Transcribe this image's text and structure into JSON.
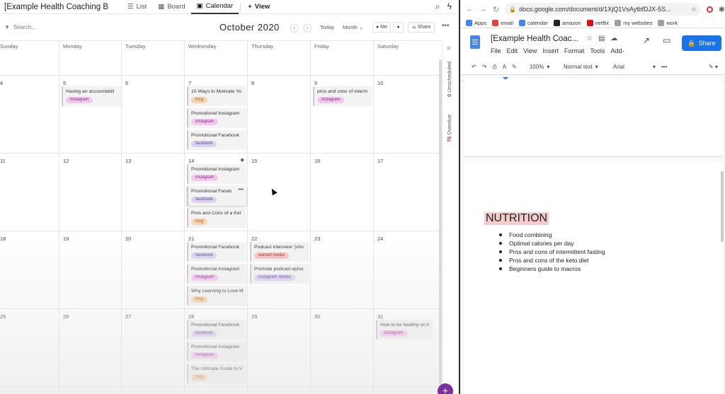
{
  "clickup": {
    "title": "[Example Health Coaching B",
    "tabs": [
      {
        "label": "List",
        "icon": "list-icon"
      },
      {
        "label": "Board",
        "icon": "board-icon"
      },
      {
        "label": "Calendar",
        "icon": "calendar-icon",
        "active": true
      }
    ],
    "add_view": "View",
    "search_placeholder": "Search...",
    "month_label": "October 2020",
    "today_label": "Today",
    "mode_label": "Month",
    "me_label": "Me",
    "share_label": "Share",
    "day_headers": [
      "Sunday",
      "Monday",
      "Tuesday",
      "Wednesday",
      "Thursday",
      "Friday",
      "Saturday"
    ],
    "weeks": [
      [
        "4",
        "5",
        "6",
        "7",
        "8",
        "9",
        "10"
      ],
      [
        "11",
        "12",
        "13",
        "14",
        "15",
        "16",
        "17"
      ],
      [
        "18",
        "19",
        "20",
        "21",
        "22",
        "23",
        "24"
      ],
      [
        "25",
        "26",
        "27",
        "28",
        "29",
        "30",
        "31"
      ]
    ],
    "tasks": [
      {
        "week": 0,
        "day": 1,
        "slot": 0,
        "name": "Having an accountabili",
        "tag": "instagram"
      },
      {
        "week": 0,
        "day": 3,
        "slot": 0,
        "name": "10 Ways to Motivate Yo",
        "tag": "blog"
      },
      {
        "week": 0,
        "day": 3,
        "slot": 1,
        "name": "Promotional Instagram",
        "tag": "instagram"
      },
      {
        "week": 0,
        "day": 3,
        "slot": 2,
        "name": "Promotional Facebook",
        "tag": "facebook"
      },
      {
        "week": 0,
        "day": 5,
        "slot": 0,
        "name": "pros and cons of interm",
        "tag": "instagram"
      },
      {
        "week": 1,
        "day": 3,
        "slot": 0,
        "name": "Promotional Instagram",
        "tag": "instagram"
      },
      {
        "week": 1,
        "day": 3,
        "slot": 1,
        "name": "Promotional Faceb",
        "tag": "facebook"
      },
      {
        "week": 1,
        "day": 3,
        "slot": 2,
        "name": "Pros and Cons of a Ket",
        "tag": "blog"
      },
      {
        "week": 2,
        "day": 3,
        "slot": 0,
        "name": "Promotional Facebook",
        "tag": "facebook"
      },
      {
        "week": 2,
        "day": 3,
        "slot": 1,
        "name": "Promotional Instagram",
        "tag": "instagram"
      },
      {
        "week": 2,
        "day": 3,
        "slot": 2,
        "name": "Why Learning to Love M",
        "tag": "blog"
      },
      {
        "week": 2,
        "day": 4,
        "slot": 0,
        "name": "Podcast interview: [sho",
        "tag": "earned media"
      },
      {
        "week": 2,
        "day": 4,
        "slot": 1,
        "name": "Promote podcast episo",
        "tag": "instagram stories"
      },
      {
        "week": 3,
        "day": 3,
        "slot": 0,
        "name": "Promotional Facebook",
        "tag": "facebook"
      },
      {
        "week": 3,
        "day": 3,
        "slot": 1,
        "name": "Promotional Instagram",
        "tag": "instagram"
      },
      {
        "week": 3,
        "day": 3,
        "slot": 2,
        "name": "The Ultimate Guide to V",
        "tag": "blog"
      },
      {
        "week": 3,
        "day": 6,
        "slot": 0,
        "name": "How to be healthy on h",
        "tag": "instagram"
      }
    ],
    "sidebar": {
      "unscheduled_count": "0",
      "unscheduled_label": "Unscheduled",
      "overdue_count": "76",
      "overdue_label": "Overdue"
    }
  },
  "browser": {
    "url": "docs.google.com/document/d/1XjQ1VsAytbfDJX-5S...",
    "bookmarks": [
      {
        "label": "Apps",
        "color": "#4285f4"
      },
      {
        "label": "email",
        "color": "#ea4335"
      },
      {
        "label": "calendar",
        "color": "#4285f4"
      },
      {
        "label": "amazon",
        "color": "#222222"
      },
      {
        "label": "netflix",
        "color": "#e50914"
      },
      {
        "label": "my websites",
        "color": "#9aa0a6"
      },
      {
        "label": "work",
        "color": "#9aa0a6"
      }
    ]
  },
  "docs": {
    "title": "[Example Health Coac...",
    "menu": [
      "File",
      "Edit",
      "View",
      "Insert",
      "Format",
      "Tools",
      "Add-"
    ],
    "share_label": "Share",
    "zoom": "100%",
    "style": "Normal text",
    "font": "Arial",
    "heading": "NUTRITION",
    "bullets": [
      "Food combining",
      "Optimal calories per day",
      "Pros and cons of intermittent fasting",
      "Pros and cons of the keto diet",
      "Beginners guide to macros"
    ]
  },
  "colors": {
    "instagram": "#f2c8ee",
    "blog": "#f6d4b4",
    "facebook": "#dcd2f0",
    "earned_media": "#f6c4c4",
    "docs_blue": "#1a73e8",
    "overdue_red": "#d6323c"
  }
}
